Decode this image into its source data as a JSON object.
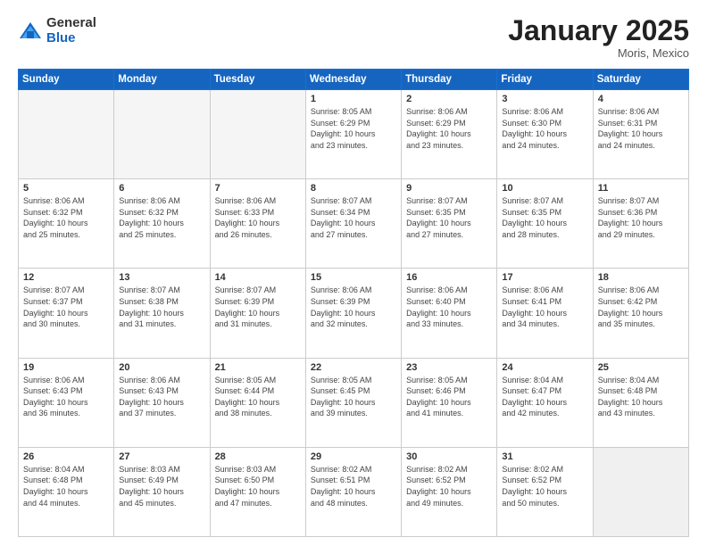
{
  "logo": {
    "general": "General",
    "blue": "Blue"
  },
  "header": {
    "month": "January 2025",
    "location": "Moris, Mexico"
  },
  "days_of_week": [
    "Sunday",
    "Monday",
    "Tuesday",
    "Wednesday",
    "Thursday",
    "Friday",
    "Saturday"
  ],
  "weeks": [
    [
      {
        "day": "",
        "info": "",
        "empty": true
      },
      {
        "day": "",
        "info": "",
        "empty": true
      },
      {
        "day": "",
        "info": "",
        "empty": true
      },
      {
        "day": "1",
        "info": "Sunrise: 8:05 AM\nSunset: 6:29 PM\nDaylight: 10 hours\nand 23 minutes."
      },
      {
        "day": "2",
        "info": "Sunrise: 8:06 AM\nSunset: 6:29 PM\nDaylight: 10 hours\nand 23 minutes."
      },
      {
        "day": "3",
        "info": "Sunrise: 8:06 AM\nSunset: 6:30 PM\nDaylight: 10 hours\nand 24 minutes."
      },
      {
        "day": "4",
        "info": "Sunrise: 8:06 AM\nSunset: 6:31 PM\nDaylight: 10 hours\nand 24 minutes."
      }
    ],
    [
      {
        "day": "5",
        "info": "Sunrise: 8:06 AM\nSunset: 6:32 PM\nDaylight: 10 hours\nand 25 minutes."
      },
      {
        "day": "6",
        "info": "Sunrise: 8:06 AM\nSunset: 6:32 PM\nDaylight: 10 hours\nand 25 minutes."
      },
      {
        "day": "7",
        "info": "Sunrise: 8:06 AM\nSunset: 6:33 PM\nDaylight: 10 hours\nand 26 minutes."
      },
      {
        "day": "8",
        "info": "Sunrise: 8:07 AM\nSunset: 6:34 PM\nDaylight: 10 hours\nand 27 minutes."
      },
      {
        "day": "9",
        "info": "Sunrise: 8:07 AM\nSunset: 6:35 PM\nDaylight: 10 hours\nand 27 minutes."
      },
      {
        "day": "10",
        "info": "Sunrise: 8:07 AM\nSunset: 6:35 PM\nDaylight: 10 hours\nand 28 minutes."
      },
      {
        "day": "11",
        "info": "Sunrise: 8:07 AM\nSunset: 6:36 PM\nDaylight: 10 hours\nand 29 minutes."
      }
    ],
    [
      {
        "day": "12",
        "info": "Sunrise: 8:07 AM\nSunset: 6:37 PM\nDaylight: 10 hours\nand 30 minutes."
      },
      {
        "day": "13",
        "info": "Sunrise: 8:07 AM\nSunset: 6:38 PM\nDaylight: 10 hours\nand 31 minutes."
      },
      {
        "day": "14",
        "info": "Sunrise: 8:07 AM\nSunset: 6:39 PM\nDaylight: 10 hours\nand 31 minutes."
      },
      {
        "day": "15",
        "info": "Sunrise: 8:06 AM\nSunset: 6:39 PM\nDaylight: 10 hours\nand 32 minutes."
      },
      {
        "day": "16",
        "info": "Sunrise: 8:06 AM\nSunset: 6:40 PM\nDaylight: 10 hours\nand 33 minutes."
      },
      {
        "day": "17",
        "info": "Sunrise: 8:06 AM\nSunset: 6:41 PM\nDaylight: 10 hours\nand 34 minutes."
      },
      {
        "day": "18",
        "info": "Sunrise: 8:06 AM\nSunset: 6:42 PM\nDaylight: 10 hours\nand 35 minutes."
      }
    ],
    [
      {
        "day": "19",
        "info": "Sunrise: 8:06 AM\nSunset: 6:43 PM\nDaylight: 10 hours\nand 36 minutes."
      },
      {
        "day": "20",
        "info": "Sunrise: 8:06 AM\nSunset: 6:43 PM\nDaylight: 10 hours\nand 37 minutes."
      },
      {
        "day": "21",
        "info": "Sunrise: 8:05 AM\nSunset: 6:44 PM\nDaylight: 10 hours\nand 38 minutes."
      },
      {
        "day": "22",
        "info": "Sunrise: 8:05 AM\nSunset: 6:45 PM\nDaylight: 10 hours\nand 39 minutes."
      },
      {
        "day": "23",
        "info": "Sunrise: 8:05 AM\nSunset: 6:46 PM\nDaylight: 10 hours\nand 41 minutes."
      },
      {
        "day": "24",
        "info": "Sunrise: 8:04 AM\nSunset: 6:47 PM\nDaylight: 10 hours\nand 42 minutes."
      },
      {
        "day": "25",
        "info": "Sunrise: 8:04 AM\nSunset: 6:48 PM\nDaylight: 10 hours\nand 43 minutes."
      }
    ],
    [
      {
        "day": "26",
        "info": "Sunrise: 8:04 AM\nSunset: 6:48 PM\nDaylight: 10 hours\nand 44 minutes."
      },
      {
        "day": "27",
        "info": "Sunrise: 8:03 AM\nSunset: 6:49 PM\nDaylight: 10 hours\nand 45 minutes."
      },
      {
        "day": "28",
        "info": "Sunrise: 8:03 AM\nSunset: 6:50 PM\nDaylight: 10 hours\nand 47 minutes."
      },
      {
        "day": "29",
        "info": "Sunrise: 8:02 AM\nSunset: 6:51 PM\nDaylight: 10 hours\nand 48 minutes."
      },
      {
        "day": "30",
        "info": "Sunrise: 8:02 AM\nSunset: 6:52 PM\nDaylight: 10 hours\nand 49 minutes."
      },
      {
        "day": "31",
        "info": "Sunrise: 8:02 AM\nSunset: 6:52 PM\nDaylight: 10 hours\nand 50 minutes."
      },
      {
        "day": "",
        "info": "",
        "empty": true
      }
    ]
  ]
}
